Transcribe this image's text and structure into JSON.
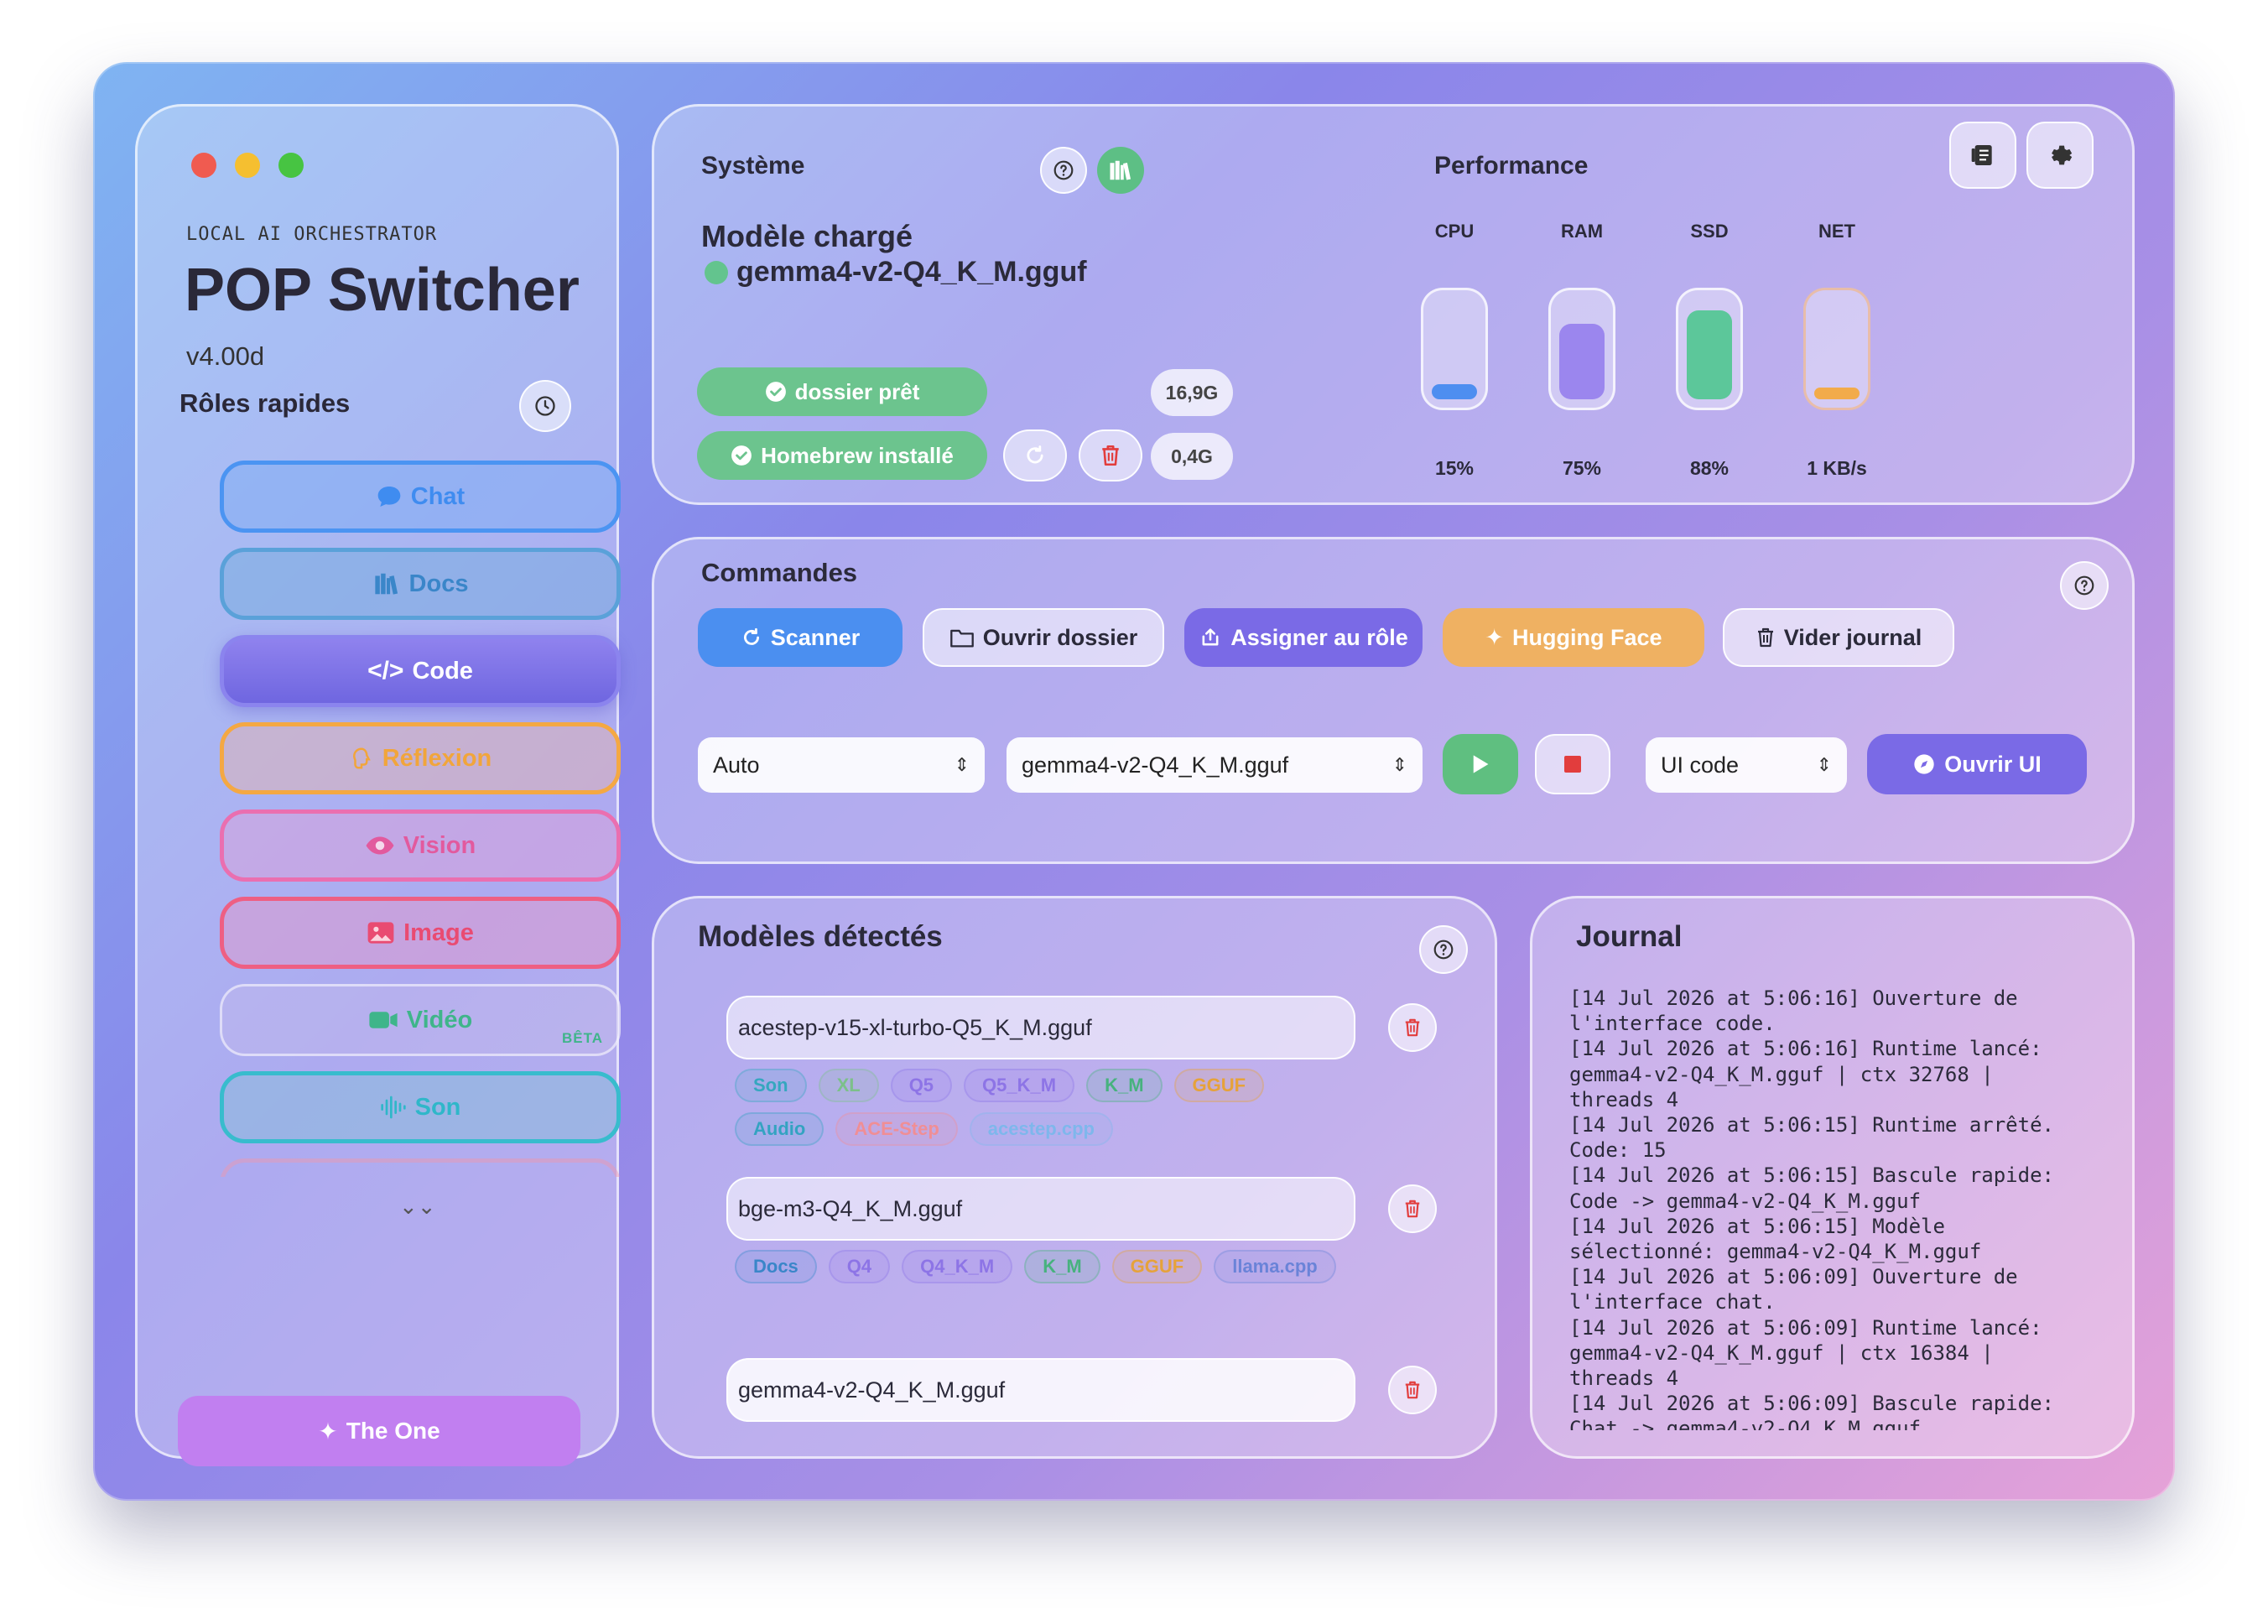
{
  "sidebar": {
    "subtitle": "LOCAL AI ORCHESTRATOR",
    "app_name": "POP Switcher",
    "version": "v4.00d",
    "roles_title": "Rôles rapides",
    "roles": [
      {
        "label": "Chat",
        "icon": "chat-bubble-icon",
        "color": "#3f8cf0"
      },
      {
        "label": "Docs",
        "icon": "library-icon",
        "color": "#3a86c9"
      },
      {
        "label": "Code",
        "icon": "code-brackets-icon",
        "color": "#7066e0"
      },
      {
        "label": "Réflexion",
        "icon": "brain-icon",
        "color": "#f1a53b"
      },
      {
        "label": "Vision",
        "icon": "eye-icon",
        "color": "#e25a9e"
      },
      {
        "label": "Image",
        "icon": "photo-icon",
        "color": "#e94b72"
      },
      {
        "label": "Vidéo",
        "icon": "video-camera-icon",
        "color": "#3fb58a",
        "badge": "BÊTA"
      },
      {
        "label": "Son",
        "icon": "waveform-icon",
        "color": "#2fb7c9"
      }
    ],
    "more_indicator": "⌄⌄",
    "the_one_label": "The One"
  },
  "system": {
    "title": "Système",
    "model_loaded_label": "Modèle chargé",
    "model_loaded_name": "gemma4-v2-Q4_K_M.gguf",
    "status_folder": "dossier prêt",
    "status_homebrew": "Homebrew installé",
    "size_a": "16,9G",
    "size_b": "0,4G"
  },
  "performance": {
    "title": "Performance",
    "gauges": [
      {
        "label": "CPU",
        "value": "15%",
        "fill": 0.15,
        "color": "#4e8ef0"
      },
      {
        "label": "RAM",
        "value": "75%",
        "fill": 0.75,
        "color": "#9b86ee"
      },
      {
        "label": "SSD",
        "value": "88%",
        "fill": 0.88,
        "color": "#5cc79a"
      },
      {
        "label": "NET",
        "value": "1 KB/s",
        "fill": 0.12,
        "color": "#f2ab4a"
      }
    ]
  },
  "commands": {
    "title": "Commandes",
    "buttons": {
      "scan": "Scanner",
      "open_folder": "Ouvrir dossier",
      "assign": "Assigner au rôle",
      "hugging_face": "Hugging Face",
      "clear_log": "Vider journal"
    },
    "mode_select": "Auto",
    "model_select": "gemma4-v2-Q4_K_M.gguf",
    "ui_select": "UI code",
    "open_ui": "Ouvrir UI"
  },
  "models": {
    "title": "Modèles détectés",
    "items": [
      {
        "name": "acestep-v15-xl-turbo-Q5_K_M.gguf",
        "tags": [
          {
            "label": "Son",
            "color": "#35a7bf"
          },
          {
            "label": "XL",
            "color": "#7cc08a"
          },
          {
            "label": "Q5",
            "color": "#8d74e6"
          },
          {
            "label": "Q5_K_M",
            "color": "#8d74e6"
          },
          {
            "label": "K_M",
            "color": "#47b27e"
          },
          {
            "label": "GGUF",
            "color": "#e6a23a"
          },
          {
            "label": "Audio",
            "color": "#33a3c1"
          },
          {
            "label": "ACE-Step",
            "color": "#f08e95"
          },
          {
            "label": "acestep.cpp",
            "color": "#7eb7ec"
          }
        ]
      },
      {
        "name": "bge-m3-Q4_K_M.gguf",
        "tags": [
          {
            "label": "Docs",
            "color": "#3a86c9"
          },
          {
            "label": "Q4",
            "color": "#8d74e6"
          },
          {
            "label": "Q4_K_M",
            "color": "#8d74e6"
          },
          {
            "label": "K_M",
            "color": "#47b27e"
          },
          {
            "label": "GGUF",
            "color": "#e6a23a"
          },
          {
            "label": "llama.cpp",
            "color": "#6a83d8"
          }
        ]
      },
      {
        "name": "gemma4-v2-Q4_K_M.gguf",
        "tags": []
      }
    ]
  },
  "journal": {
    "title": "Journal",
    "text": "[14 Jul 2026 at 5:06:16] Ouverture de\nl'interface code.\n[14 Jul 2026 at 5:06:16] Runtime lancé:\ngemma4-v2-Q4_K_M.gguf | ctx 32768 |\nthreads 4\n[14 Jul 2026 at 5:06:15] Runtime arrêté.\nCode: 15\n[14 Jul 2026 at 5:06:15] Bascule rapide:\nCode -> gemma4-v2-Q4_K_M.gguf\n[14 Jul 2026 at 5:06:15] Modèle\nsélectionné: gemma4-v2-Q4_K_M.gguf\n[14 Jul 2026 at 5:06:09] Ouverture de\nl'interface chat.\n[14 Jul 2026 at 5:06:09] Runtime lancé:\ngemma4-v2-Q4_K_M.gguf | ctx 16384 |\nthreads 4\n[14 Jul 2026 at 5:06:09] Bascule rapide:\nChat -> gemma4-v2-Q4_K_M.gguf"
  },
  "colors": {
    "accent_blue": "#4b8ff0",
    "accent_purple": "#7a6ae6",
    "accent_orange": "#efb162",
    "success_green": "#63c48e",
    "danger_red": "#e23d3d",
    "the_one_purple": "#c17ff0"
  }
}
